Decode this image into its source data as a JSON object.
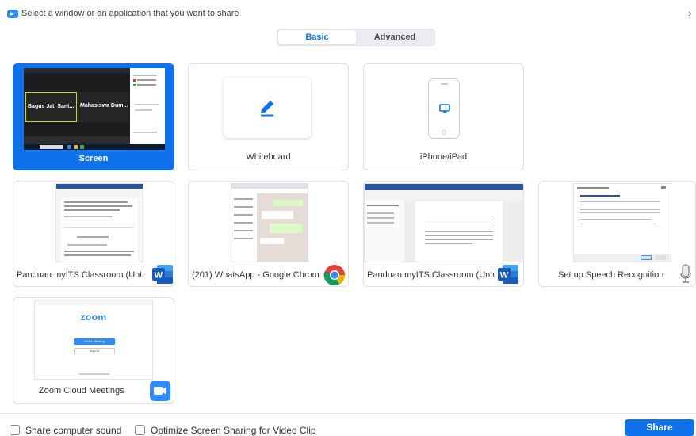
{
  "window": {
    "title": "Select a window or an application that you want to share"
  },
  "tabs": [
    {
      "label": "Basic",
      "selected": true
    },
    {
      "label": "Advanced",
      "selected": false
    }
  ],
  "tiles": [
    {
      "label": "Screen",
      "selected": true
    },
    {
      "label": "Whiteboard"
    },
    {
      "label": "iPhone/iPad"
    },
    {
      "label": "Panduan myITS Classroom (Untu...",
      "icon": "word-icon"
    },
    {
      "label": "(201) WhatsApp - Google Chrome",
      "icon": "chrome-icon"
    },
    {
      "label": "Panduan myITS Classroom (Untu...",
      "icon": "word-icon"
    },
    {
      "label": "Set up Speech Recognition",
      "icon": "microphone-icon"
    },
    {
      "label": "Zoom Cloud Meetings",
      "icon": "zoom-camera-icon"
    }
  ],
  "screen_preview": {
    "participants": [
      "Bagus Jati Sant...",
      "Mahasiswa Dum..."
    ]
  },
  "zoom_preview": {
    "logo": "zoom",
    "join_label": "Join a Meeting",
    "signin_label": "Sign In"
  },
  "options": {
    "share_sound": "Share computer sound",
    "optimize_video": "Optimize Screen Sharing for Video Clip"
  },
  "share_button": "Share",
  "colors": {
    "accent": "#0e72ed",
    "word": "#185abd",
    "zoom": "#2d8cff"
  }
}
